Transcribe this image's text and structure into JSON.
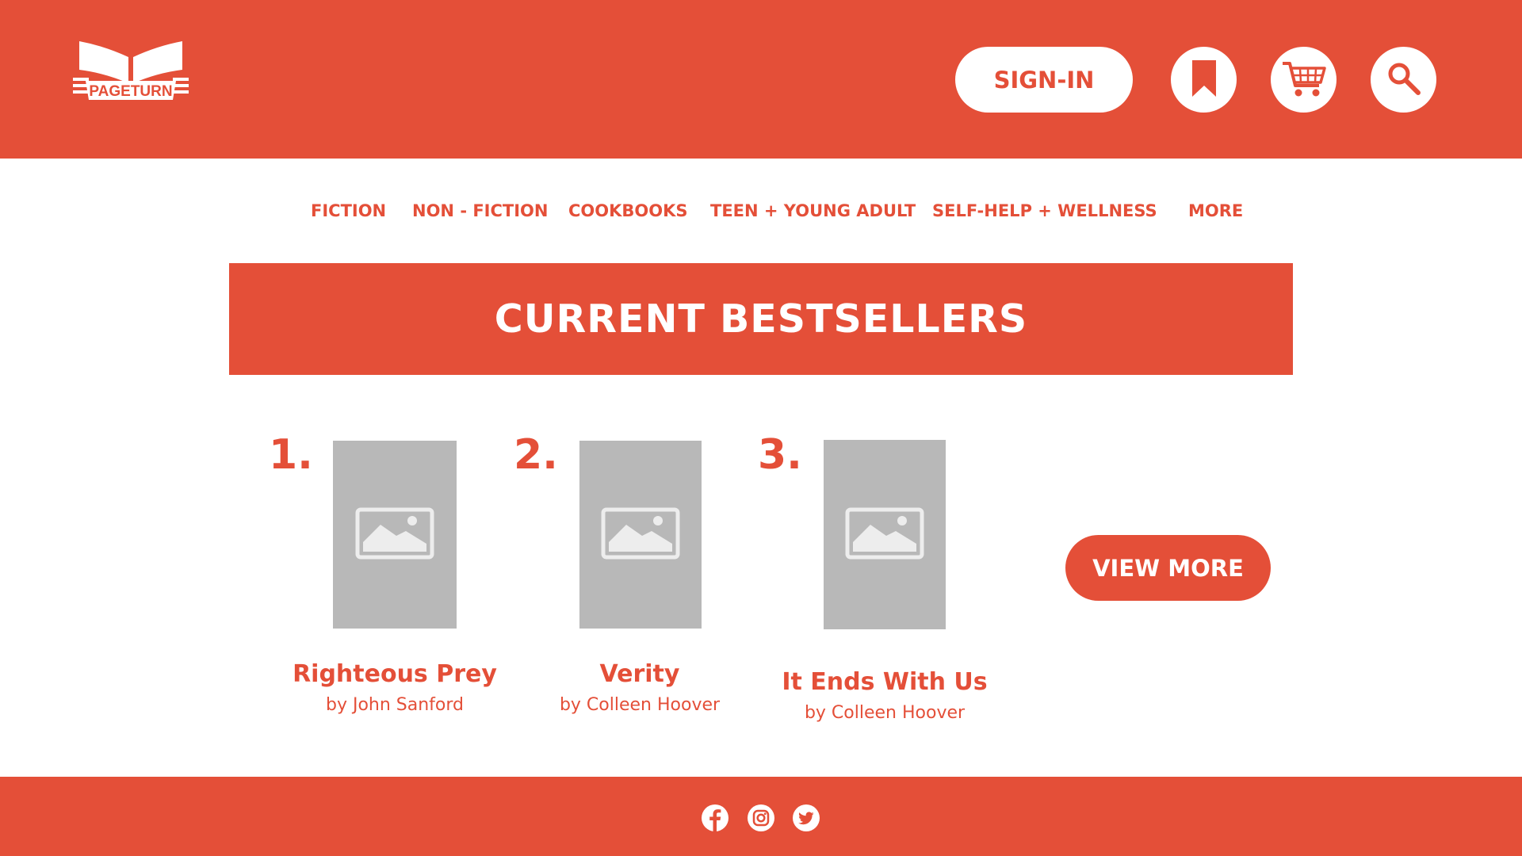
{
  "brand": {
    "name": "PAGETURN",
    "primary_color": "#e44f38"
  },
  "header": {
    "signin_label": "SIGN-IN",
    "icons": [
      "bookmark-icon",
      "cart-icon",
      "search-icon"
    ]
  },
  "nav": {
    "items": [
      {
        "label": "FICTION"
      },
      {
        "label": "NON - FICTION"
      },
      {
        "label": "COOKBOOKS"
      },
      {
        "label": "TEEN + YOUNG ADULT"
      },
      {
        "label": "SELF-HELP + WELLNESS"
      },
      {
        "label": "MORE"
      }
    ]
  },
  "bestsellers": {
    "heading": "CURRENT BESTSELLERS",
    "books": [
      {
        "rank": "1.",
        "title": "Righteous Prey",
        "author": "by John Sanford"
      },
      {
        "rank": "2.",
        "title": "Verity",
        "author": "by Colleen Hoover"
      },
      {
        "rank": "3.",
        "title": "It Ends With Us",
        "author": "by Colleen Hoover"
      }
    ],
    "view_more_label": "VIEW MORE"
  },
  "footer": {
    "social_icons": [
      "facebook-icon",
      "instagram-icon",
      "twitter-icon"
    ]
  }
}
